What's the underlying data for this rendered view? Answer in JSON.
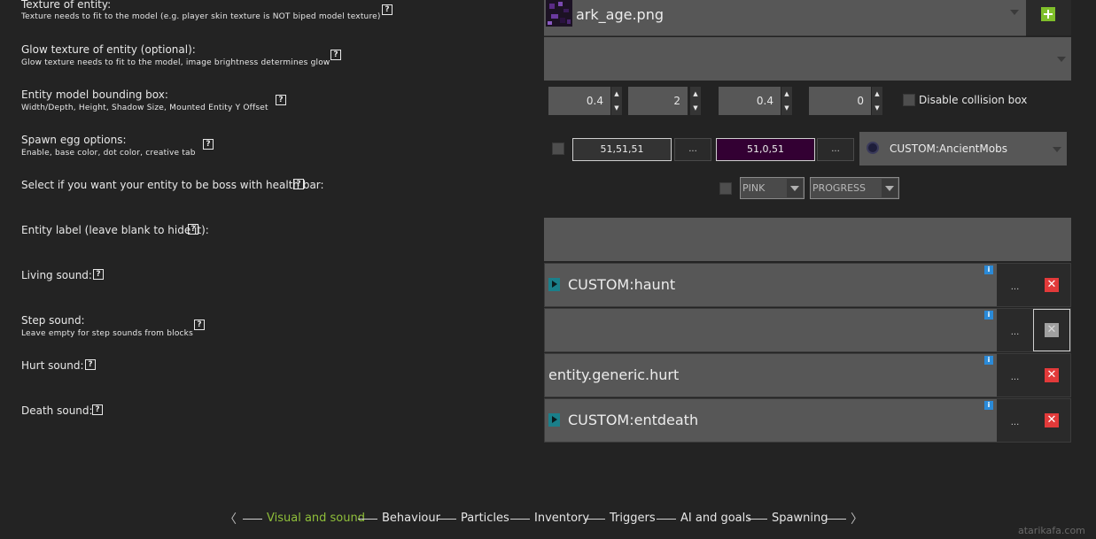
{
  "labels": {
    "texture_main": "Texture of entity:",
    "texture_sub": "Texture needs to fit to the model (e.g. player skin texture is NOT biped model texture)",
    "glow_main": "Glow texture of entity (optional):",
    "glow_sub": "Glow texture needs to fit to the model, image brightness determines glow",
    "bbox_main": "Entity model bounding box:",
    "bbox_sub": "Width/Depth, Height, Shadow Size, Mounted Entity Y Offset",
    "egg_main": "Spawn egg options:",
    "egg_sub": "Enable, base color, dot color, creative tab",
    "boss_main": "Select if you want your entity to be boss with health bar:",
    "entity_label_main": "Entity label (leave blank to hide it):",
    "living_main": "Living sound:",
    "step_main": "Step sound:",
    "step_sub": "Leave empty for step sounds from blocks",
    "hurt_main": "Hurt sound:",
    "death_main": "Death sound:"
  },
  "help_glyph": "?",
  "texture": {
    "value": "ark_age.png",
    "dropdown_icon": "chevron-down-icon",
    "add_icon": "plus-icon"
  },
  "bbox": {
    "width": "0.4",
    "height": "2",
    "shadow": "0.4",
    "offset": "0",
    "collision_label": "Disable collision box"
  },
  "spawn_egg": {
    "base_color": "51,51,51",
    "dot_color": "51,0,51",
    "dots": "...",
    "tab": "CUSTOM:AncientMobs",
    "base_color_hex": "#333333",
    "dot_color_hex": "#330033"
  },
  "boss": {
    "color": "PINK",
    "style": "PROGRESS"
  },
  "sounds": {
    "living": "CUSTOM:haunt",
    "step": "",
    "hurt": "entity.generic.hurt",
    "death": "CUSTOM:entdeath",
    "dots": "...",
    "info_glyph": "i",
    "x_glyph": "✕"
  },
  "nav": {
    "prev_glyph": "〈",
    "next_glyph": "〉",
    "tabs": [
      "Visual and sound",
      "Behaviour",
      "Particles",
      "Inventory",
      "Triggers",
      "AI and goals",
      "Spawning"
    ],
    "active_color": "#8fbf3a"
  },
  "watermark": "atarikafa.com"
}
